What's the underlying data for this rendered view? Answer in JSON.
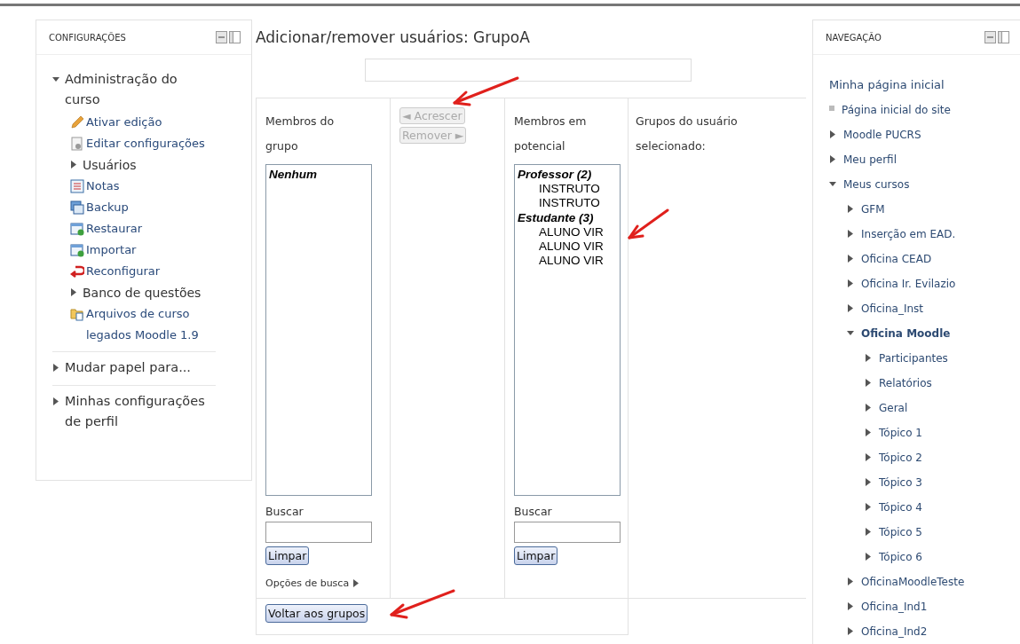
{
  "settings": {
    "title": "CONFIGURAÇÕES",
    "items": [
      {
        "kind": "branch",
        "label": "Administração do curso",
        "expanded": true,
        "children": [
          {
            "kind": "pencil",
            "label": "Ativar edição"
          },
          {
            "kind": "settings",
            "label": "Editar configurações"
          },
          {
            "kind": "branch",
            "label": "Usuários",
            "expanded": false
          },
          {
            "kind": "grades",
            "label": "Notas"
          },
          {
            "kind": "backup",
            "label": "Backup"
          },
          {
            "kind": "restore",
            "label": "Restaurar"
          },
          {
            "kind": "restore",
            "label": "Importar"
          },
          {
            "kind": "reset",
            "label": "Reconfigurar"
          },
          {
            "kind": "branch",
            "label": "Banco de questões",
            "expanded": false
          },
          {
            "kind": "folder",
            "label": "Arquivos de curso legados Moodle 1.9"
          }
        ]
      },
      {
        "kind": "branch",
        "label": "Mudar papel para...",
        "expanded": false
      },
      {
        "kind": "branch",
        "label": "Minhas configurações de perfil",
        "expanded": false
      }
    ]
  },
  "main": {
    "title": "Adicionar/remover usuários: GrupoA",
    "members": {
      "label": "Membros do grupo",
      "options": [
        {
          "kind": "group",
          "text": "Nenhum"
        }
      ],
      "search_label": "Buscar",
      "clear_button": "Limpar",
      "search_options": "Opções de busca"
    },
    "actions": [
      {
        "label": "◄ Acrescer",
        "disabled": true
      },
      {
        "label": "Remover ►",
        "disabled": true
      }
    ],
    "potential": {
      "label": "Membros em potencial",
      "options": [
        {
          "kind": "group",
          "text": "Professor (2)"
        },
        {
          "kind": "option",
          "text": "INSTRUTO"
        },
        {
          "kind": "option",
          "text": "INSTRUTO"
        },
        {
          "kind": "group",
          "text": "Estudante (3)"
        },
        {
          "kind": "option",
          "text": "ALUNO VIR"
        },
        {
          "kind": "option",
          "text": "ALUNO VIR"
        },
        {
          "kind": "option",
          "text": "ALUNO VIR"
        }
      ],
      "search_label": "Buscar",
      "clear_button": "Limpar"
    },
    "user_groups_label": "Grupos do usuário selecionado:",
    "back_button": "Voltar aos grupos"
  },
  "navigation": {
    "title": "NAVEGAÇÃO",
    "items": [
      {
        "kind": "plain",
        "label": "Minha página inicial"
      },
      {
        "kind": "bullet",
        "label": "Página inicial do site"
      },
      {
        "kind": "branch",
        "label": "Moodle PUCRS",
        "expanded": false
      },
      {
        "kind": "branch",
        "label": "Meu perfil",
        "expanded": false
      },
      {
        "kind": "branch",
        "label": "Meus cursos",
        "expanded": true,
        "children": [
          {
            "kind": "branch",
            "label": "GFM",
            "expanded": false
          },
          {
            "kind": "branch",
            "label": "Inserção em EAD.",
            "expanded": false
          },
          {
            "kind": "branch",
            "label": "Oficina CEAD",
            "expanded": false
          },
          {
            "kind": "branch",
            "label": "Oficina Ir. Evilazio",
            "expanded": false
          },
          {
            "kind": "branch",
            "label": "Oficina_Inst",
            "expanded": false
          },
          {
            "kind": "branch",
            "label": "Oficina Moodle",
            "expanded": true,
            "current": true,
            "children": [
              {
                "kind": "branch",
                "label": "Participantes",
                "expanded": false
              },
              {
                "kind": "branch",
                "label": "Relatórios",
                "expanded": false
              },
              {
                "kind": "branch",
                "label": "Geral",
                "expanded": false
              },
              {
                "kind": "branch",
                "label": "Tópico 1",
                "expanded": false
              },
              {
                "kind": "branch",
                "label": "Tópico 2",
                "expanded": false
              },
              {
                "kind": "branch",
                "label": "Tópico 3",
                "expanded": false
              },
              {
                "kind": "branch",
                "label": "Tópico 4",
                "expanded": false
              },
              {
                "kind": "branch",
                "label": "Tópico 5",
                "expanded": false
              },
              {
                "kind": "branch",
                "label": "Tópico 6",
                "expanded": false
              }
            ]
          },
          {
            "kind": "branch",
            "label": "OficinaMoodleTeste",
            "expanded": false
          },
          {
            "kind": "branch",
            "label": "Oficina_Ind1",
            "expanded": false
          },
          {
            "kind": "branch",
            "label": "Oficina_Ind2",
            "expanded": false
          }
        ]
      }
    ]
  }
}
